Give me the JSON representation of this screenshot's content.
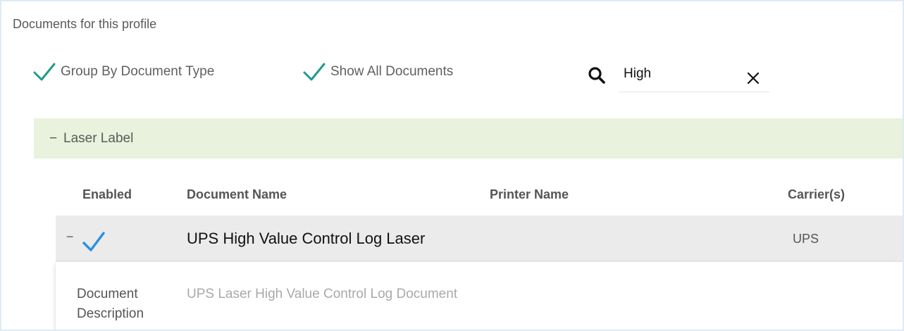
{
  "section": {
    "title": "Documents for this profile"
  },
  "options": {
    "group_by": "Group By Document Type",
    "show_all": "Show All Documents"
  },
  "search": {
    "value": "High"
  },
  "group": {
    "toggle": "−",
    "label": "Laser Label"
  },
  "columns": {
    "enabled": "Enabled",
    "document_name": "Document Name",
    "printer_name": "Printer Name",
    "carriers": "Carrier(s)"
  },
  "row": {
    "toggle": "−",
    "document_name": "UPS High Value Control Log Laser",
    "printer_name": "",
    "carrier": "UPS"
  },
  "detail": {
    "label": "Document Description",
    "value": "UPS Laser High Value Control Log Document"
  },
  "colors": {
    "teal_check": "#1f9b8a",
    "blue_check": "#2a8fe0",
    "group_bg": "#e8f2dc",
    "row_bg": "#ebebeb"
  },
  "icons": {
    "check": "check-icon",
    "search": "search-icon",
    "clear": "close-icon"
  }
}
